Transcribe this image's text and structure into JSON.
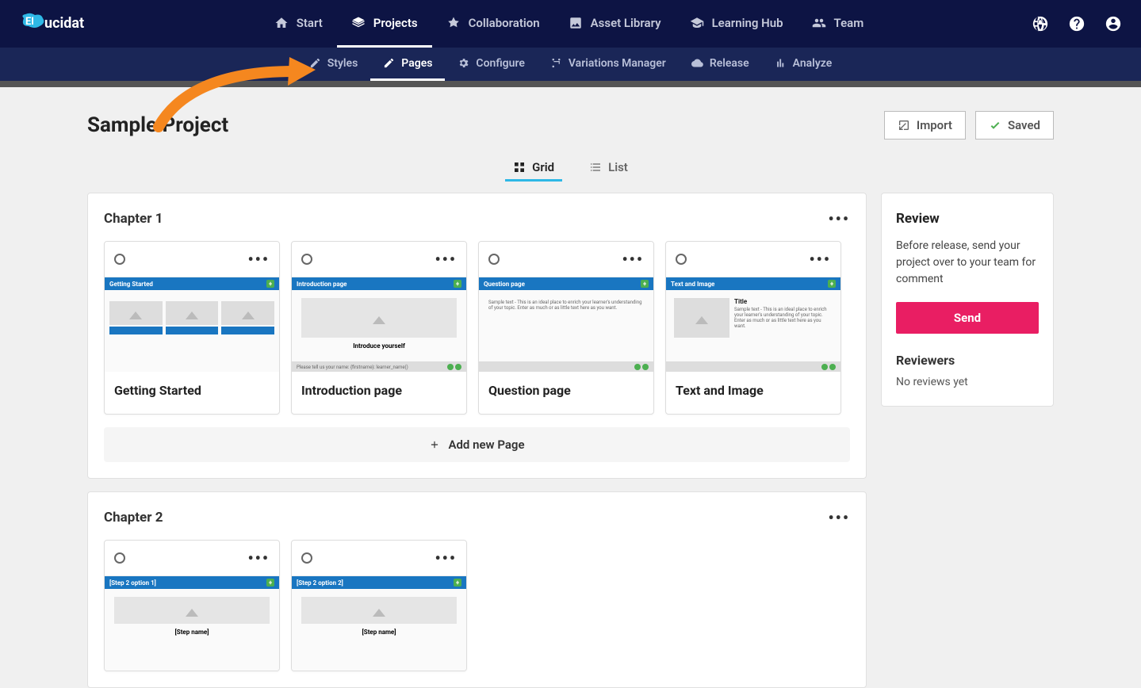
{
  "logo_text": "Elucidat",
  "topnav": [
    {
      "label": "Start",
      "active": false
    },
    {
      "label": "Projects",
      "active": true
    },
    {
      "label": "Collaboration",
      "active": false
    },
    {
      "label": "Asset Library",
      "active": false
    },
    {
      "label": "Learning Hub",
      "active": false
    },
    {
      "label": "Team",
      "active": false
    }
  ],
  "subnav": [
    {
      "label": "Styles",
      "active": false
    },
    {
      "label": "Pages",
      "active": true
    },
    {
      "label": "Configure",
      "active": false
    },
    {
      "label": "Variations Manager",
      "active": false
    },
    {
      "label": "Release",
      "active": false
    },
    {
      "label": "Analyze",
      "active": false
    }
  ],
  "page_title": "Sample Project",
  "buttons": {
    "import": "Import",
    "saved": "Saved"
  },
  "view_tabs": {
    "grid": "Grid",
    "list": "List"
  },
  "chapters": [
    {
      "title": "Chapter 1",
      "pages": [
        {
          "label": "Getting Started",
          "thumb_title": "Getting Started",
          "thumb_type": "gs"
        },
        {
          "label": "Introduction page",
          "thumb_title": "Introduction page",
          "thumb_type": "intro",
          "thumb_text": "Introduce yourself",
          "thumb_footer": "Please tell us your name: {firstname}: learner_name()"
        },
        {
          "label": "Question page",
          "thumb_title": "Question page",
          "thumb_type": "question",
          "thumb_text": "Sample text - This is an ideal place to enrich your learner's understanding of your topic. Enter as much or as little text here as you want."
        },
        {
          "label": "Text and Image",
          "thumb_title": "Text and Image",
          "thumb_type": "textimage",
          "thumb_heading": "Title",
          "thumb_text": "Sample text - This is an ideal place to enrich your learner's understanding of your topic. Enter as much or as little text here as you want."
        }
      ]
    },
    {
      "title": "Chapter 2",
      "pages": [
        {
          "label": "",
          "thumb_title": "[Step 2 option 1]",
          "thumb_type": "step",
          "thumb_text": "[Step name]"
        },
        {
          "label": "",
          "thumb_title": "[Step 2 option 2]",
          "thumb_type": "step",
          "thumb_text": "[Step name]"
        }
      ]
    }
  ],
  "add_page": "Add new Page",
  "review": {
    "title": "Review",
    "text": "Before release, send your project over to your team for comment",
    "send": "Send",
    "reviewers_title": "Reviewers",
    "reviewers_text": "No reviews yet"
  }
}
